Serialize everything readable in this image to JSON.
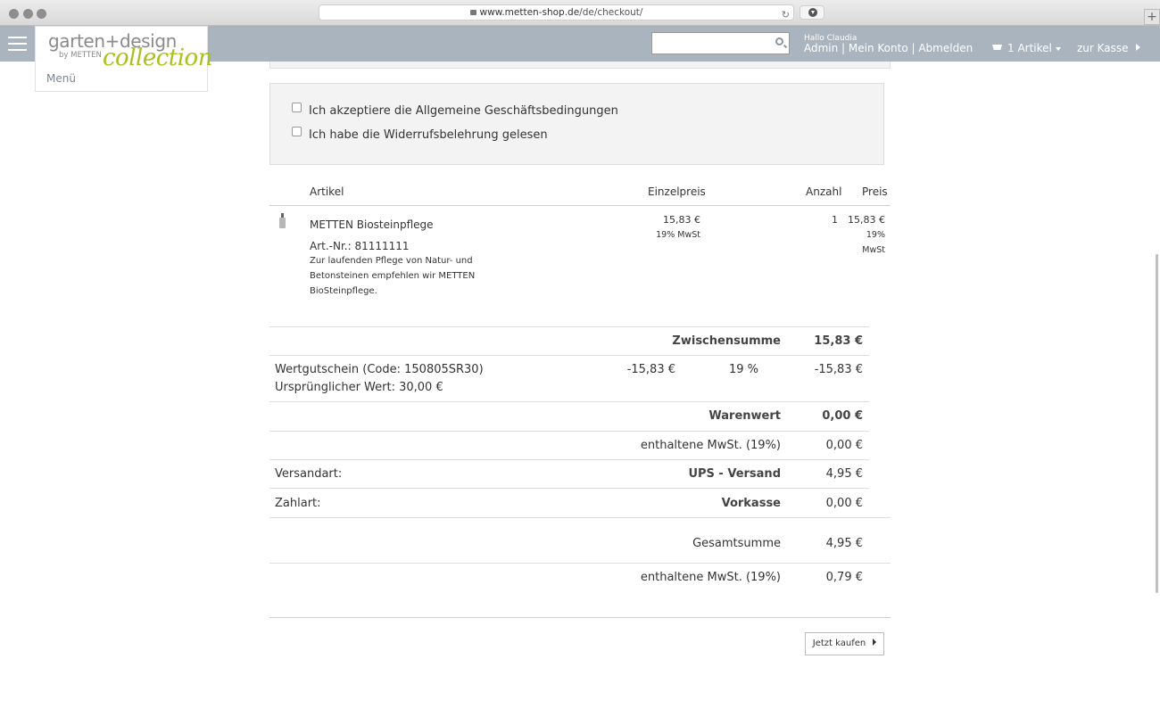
{
  "browser": {
    "url_domain": "www.metten-shop.de",
    "url_path": "/de/checkout/"
  },
  "logo": {
    "line1": "garten+design",
    "line2": "by METTEN",
    "line3": "collection"
  },
  "header": {
    "menu_label": "Menü",
    "greeting": "Hallo Claudia",
    "account": "Admin | Mein Konto | Abmelden",
    "cart": "1 Artikel",
    "checkout": "zur Kasse"
  },
  "terms": {
    "agb": "Ich akzeptiere die Allgemeine Geschäftsbedingungen",
    "widerruf": "Ich habe die Widerrufsbelehrung gelesen"
  },
  "table": {
    "col_article": "Artikel",
    "col_unit_price": "Einzelpreis",
    "col_quantity": "Anzahl",
    "col_price": "Preis"
  },
  "item": {
    "name": "METTEN Biosteinpflege",
    "artnr": "Art.-Nr.: 81111111",
    "desc_line1": "Zur laufenden Pflege von Natur- und",
    "desc_line2": "Betonsteinen empfehlen wir METTEN",
    "desc_line3": "BioSteinpflege.",
    "unit_price": "15,83 €",
    "unit_vat": "19% MwSt",
    "quantity": "1",
    "price": "15,83 €",
    "price_vat1": "19%",
    "price_vat2": "MwSt"
  },
  "summary": {
    "subtotal_label": "Zwischensumme",
    "subtotal": "15,83 €",
    "voucher_label": "Wertgutschein (Code: 150805SR30)",
    "voucher_original": "Ursprünglicher Wert: 30,00 €",
    "voucher_amount": "-15,83 €",
    "voucher_vat": "19 %",
    "voucher_total": "-15,83 €",
    "goods_label": "Warenwert",
    "goods": "0,00 €",
    "vat_label": "enthaltene MwSt. (19%)",
    "vat": "0,00 €",
    "shipping_label": "Versandart:",
    "shipping_method": "UPS - Versand",
    "shipping": "4,95 €",
    "payment_label": "Zahlart:",
    "payment_method": "Vorkasse",
    "payment": "0,00 €",
    "total_label": "Gesamtsumme",
    "total": "4,95 €",
    "total_vat_label": "enthaltene MwSt. (19%)",
    "total_vat": "0,79 €"
  },
  "buy_button": "Jetzt kaufen"
}
